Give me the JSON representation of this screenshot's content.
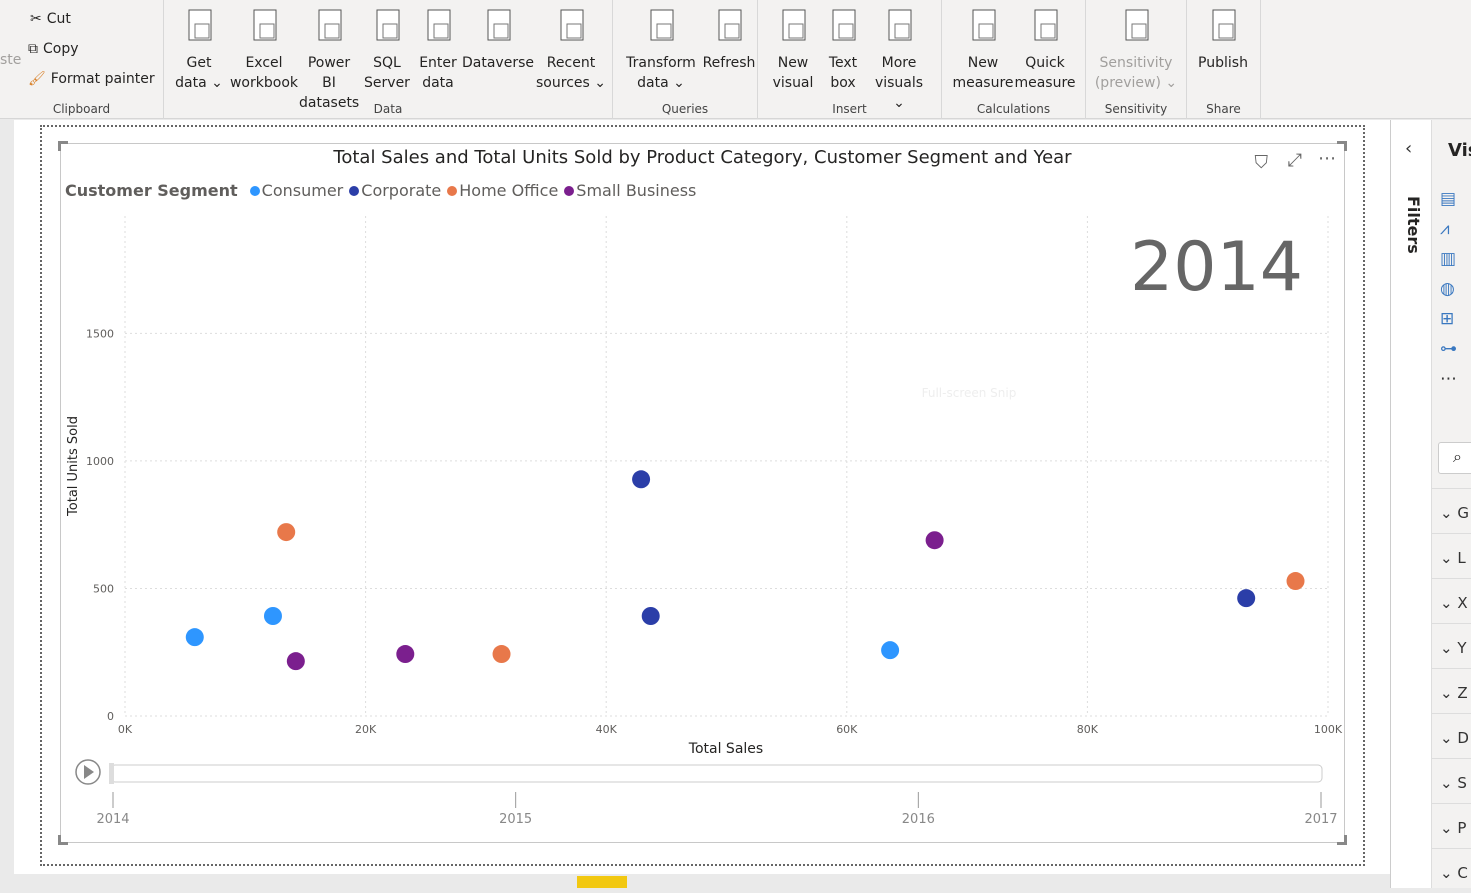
{
  "ribbon": {
    "clipboard": {
      "label": "Clipboard",
      "paste": "ste",
      "cut": "Cut",
      "copy": "Copy",
      "format_painter": "Format painter"
    },
    "data": {
      "label": "Data",
      "items": [
        [
          "Get",
          "data ⌄"
        ],
        [
          "Excel",
          "workbook"
        ],
        [
          "Power BI",
          "datasets"
        ],
        [
          "SQL",
          "Server"
        ],
        [
          "Enter",
          "data"
        ],
        [
          "Dataverse",
          ""
        ],
        [
          "Recent",
          "sources ⌄"
        ]
      ]
    },
    "queries": {
      "label": "Queries",
      "items": [
        [
          "Transform",
          "data ⌄"
        ],
        [
          "Refresh",
          ""
        ]
      ]
    },
    "insert": {
      "label": "Insert",
      "items": [
        [
          "New",
          "visual"
        ],
        [
          "Text",
          "box"
        ],
        [
          "More",
          "visuals ⌄"
        ]
      ]
    },
    "calculations": {
      "label": "Calculations",
      "items": [
        [
          "New",
          "measure"
        ],
        [
          "Quick",
          "measure"
        ]
      ]
    },
    "sensitivity": {
      "label": "Sensitivity",
      "items": [
        [
          "Sensitivity",
          "(preview) ⌄"
        ]
      ]
    },
    "share": {
      "label": "Share",
      "items": [
        [
          "Publish",
          ""
        ]
      ]
    }
  },
  "visual": {
    "title": "Total Sales and Total Units Sold by Product Category, Customer Segment and Year",
    "legend_title": "Customer Segment",
    "play_axis_current": "2014",
    "play_axis_ticks": [
      "2014",
      "2015",
      "2016",
      "2017"
    ],
    "tooltip_ghost": "Full-screen Snip"
  },
  "chart_data": {
    "type": "scatter",
    "title": "Total Sales and Total Units Sold by Product Category, Customer Segment and Year",
    "xlabel": "Total Sales",
    "ylabel": "Total Units Sold",
    "xlim": [
      0,
      100000
    ],
    "ylim": [
      0,
      1960
    ],
    "xticks": [
      0,
      20000,
      40000,
      60000,
      80000,
      100000
    ],
    "xtick_labels": [
      "0K",
      "20K",
      "40K",
      "60K",
      "80K",
      "100K"
    ],
    "yticks": [
      0,
      500,
      1000,
      1500
    ],
    "ytick_labels": [
      "0",
      "500",
      "1000",
      "1500"
    ],
    "grid": true,
    "legend": "top-left",
    "series": [
      {
        "name": "Consumer",
        "color": "#2e96ff",
        "points": [
          [
            5800,
            309
          ],
          [
            12300,
            392
          ],
          [
            63600,
            258
          ]
        ]
      },
      {
        "name": "Corporate",
        "color": "#2b3ea8",
        "points": [
          [
            42900,
            928
          ],
          [
            43700,
            392
          ],
          [
            93200,
            462
          ]
        ]
      },
      {
        "name": "Home Office",
        "color": "#e8784a",
        "points": [
          [
            13400,
            721
          ],
          [
            31300,
            243
          ],
          [
            97300,
            529
          ]
        ]
      },
      {
        "name": "Small Business",
        "color": "#7b1f8e",
        "points": [
          [
            14200,
            215
          ],
          [
            23300,
            243
          ],
          [
            67300,
            689
          ]
        ]
      }
    ]
  },
  "filters": {
    "label": "Filters"
  },
  "visualizations": {
    "label": "Vis",
    "sections": [
      "G",
      "L",
      "X",
      "Y",
      "Z",
      "D",
      "S",
      "P",
      "C"
    ]
  }
}
